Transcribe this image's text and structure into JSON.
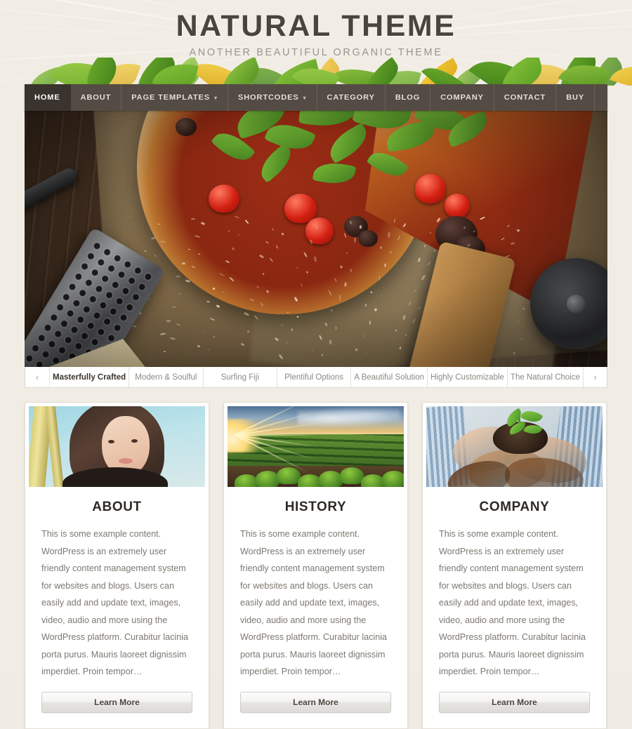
{
  "site": {
    "title": "NATURAL THEME",
    "tagline": "ANOTHER BEAUTIFUL ORGANIC THEME"
  },
  "colors": {
    "page_background": "#f1ede4",
    "nav_background": "#544c44",
    "nav_active_background": "#3b342e",
    "accent_green": "#7cb342",
    "heading_text": "#4b443d",
    "body_text": "#7d7871"
  },
  "nav": {
    "items": [
      {
        "label": "HOME",
        "active": true,
        "has_dropdown": false
      },
      {
        "label": "ABOUT",
        "active": false,
        "has_dropdown": false
      },
      {
        "label": "PAGE TEMPLATES",
        "active": false,
        "has_dropdown": true,
        "caret": "▾"
      },
      {
        "label": "SHORTCODES",
        "active": false,
        "has_dropdown": true,
        "caret": "▾"
      },
      {
        "label": "CATEGORY",
        "active": false,
        "has_dropdown": false
      },
      {
        "label": "BLOG",
        "active": false,
        "has_dropdown": false
      },
      {
        "label": "COMPANY",
        "active": false,
        "has_dropdown": false
      },
      {
        "label": "CONTACT",
        "active": false,
        "has_dropdown": false
      },
      {
        "label": "BUY",
        "active": false,
        "has_dropdown": false
      }
    ]
  },
  "slider": {
    "alt": "Rustic pizza with arugula, cherry tomatoes and parmesan on a wooden table",
    "prev_arrow": "‹",
    "next_arrow": "›",
    "tabs": [
      {
        "label": "Masterfully Crafted",
        "active": true
      },
      {
        "label": "Modern & Soulful",
        "active": false
      },
      {
        "label": "Surfing Fiji",
        "active": false
      },
      {
        "label": "Plentiful Options",
        "active": false
      },
      {
        "label": "A Beautiful Solution",
        "active": false
      },
      {
        "label": "Highly Customizable",
        "active": false
      },
      {
        "label": "The Natural Choice",
        "active": false
      }
    ]
  },
  "cards": [
    {
      "title": "ABOUT",
      "thumb_alt": "Portrait of a woman near bamboo by the sea",
      "text": "This is some example content. WordPress is an extremely user friendly content management system for websites and blogs. Users can easily add and update text, images, video, audio and more using the WordPress platform. Curabitur lacinia porta purus. Mauris laoreet dignissim imperdiet. Proin tempor…",
      "button_label": "Learn More"
    },
    {
      "title": "HISTORY",
      "thumb_alt": "Crop field rows at sunset",
      "text": "This is some example content. WordPress is an extremely user friendly content management system for websites and blogs. Users can easily add and update text, images, video, audio and more using the WordPress platform. Curabitur lacinia porta purus. Mauris laoreet dignissim imperdiet. Proin tempor…",
      "button_label": "Learn More"
    },
    {
      "title": "COMPANY",
      "thumb_alt": "Several hands holding soil with a green seedling",
      "text": "This is some example content. WordPress is an extremely user friendly content management system for websites and blogs. Users can easily add and update text, images, video, audio and more using the WordPress platform. Curabitur lacinia porta purus. Mauris laoreet dignissim imperdiet. Proin tempor…",
      "button_label": "Learn More"
    }
  ]
}
